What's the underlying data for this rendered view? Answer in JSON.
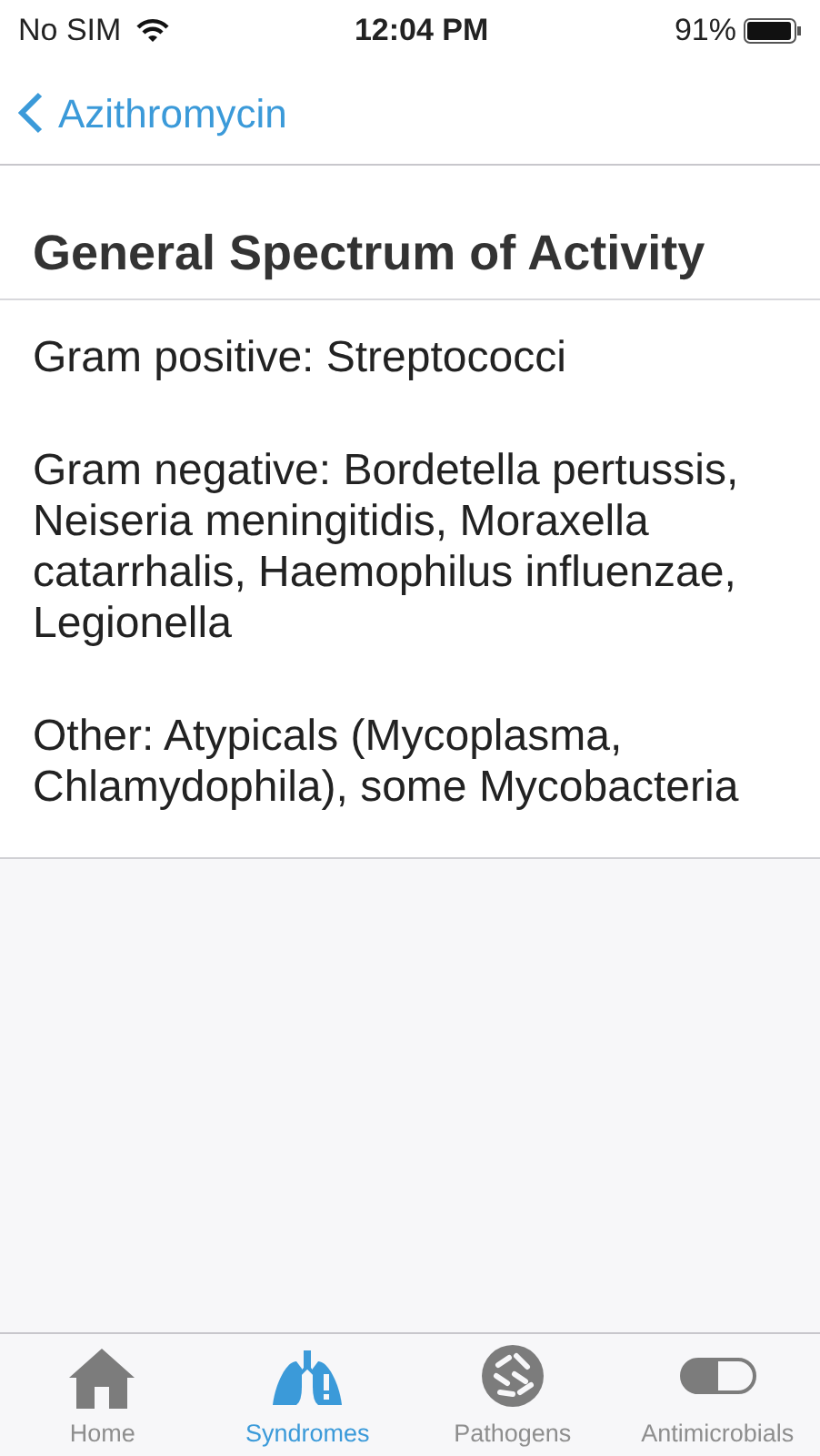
{
  "status_bar": {
    "carrier": "No SIM",
    "time": "12:04 PM",
    "battery": "91%"
  },
  "nav": {
    "back": "Azithromycin"
  },
  "section": {
    "title": "General Spectrum of Activity",
    "paragraphs": [
      "Gram positive: Streptococci",
      "Gram negative: Bordetella pertussis, Neiseria meningitidis, Moraxella catarrhalis, Haemophilus influenzae, Legionella",
      "Other: Atypicals (Mycoplasma, Chlamydophila), some Mycobacteria"
    ]
  },
  "tabs": [
    {
      "kind": "home",
      "label": "Home",
      "selected": false
    },
    {
      "kind": "lungs",
      "label": "Syndromes",
      "selected": true
    },
    {
      "kind": "microbe",
      "label": "Pathogens",
      "selected": false
    },
    {
      "kind": "pill",
      "label": "Antimicrobials",
      "selected": false
    }
  ]
}
